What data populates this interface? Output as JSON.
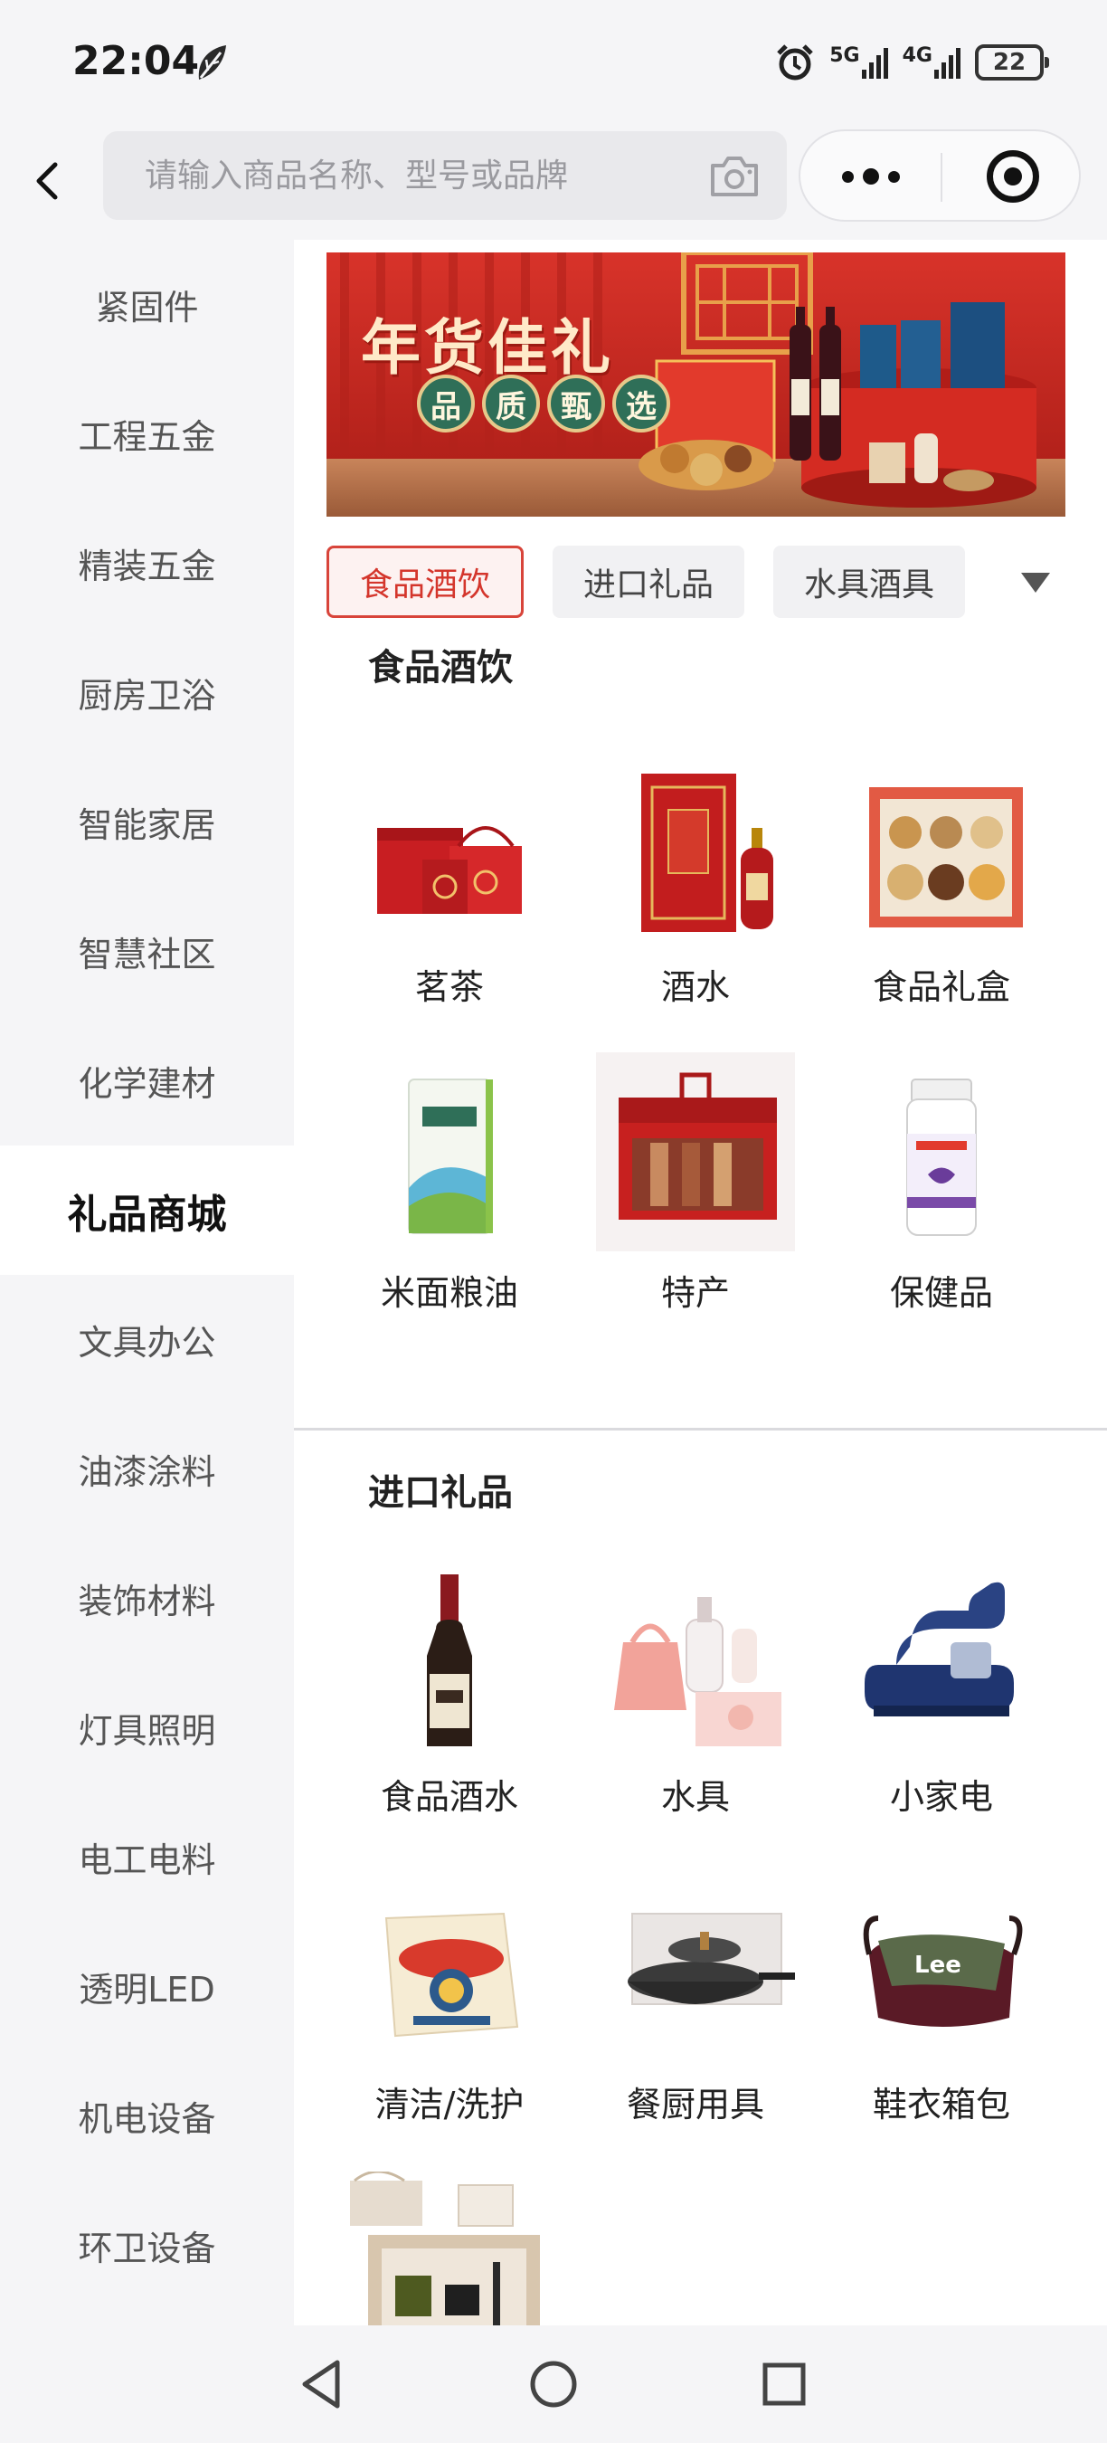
{
  "status_bar": {
    "time": "22:04",
    "network_1": "5G",
    "network_2": "4G",
    "battery": "22",
    "icons": [
      "leaf-icon",
      "alarm-icon",
      "signal-icon",
      "battery-icon"
    ]
  },
  "header": {
    "search_placeholder": "请输入商品名称、型号或品牌",
    "icons": [
      "back-arrow-icon",
      "camera-icon",
      "more-dots-icon",
      "target-close-icon"
    ]
  },
  "sidebar": {
    "items": [
      {
        "label": "紧固件"
      },
      {
        "label": "工程五金"
      },
      {
        "label": "精装五金"
      },
      {
        "label": "厨房卫浴"
      },
      {
        "label": "智能家居"
      },
      {
        "label": "智慧社区"
      },
      {
        "label": "化学建材"
      },
      {
        "label": "礼品商城"
      },
      {
        "label": "文具办公"
      },
      {
        "label": "油漆涂料"
      },
      {
        "label": "装饰材料"
      },
      {
        "label": "灯具照明"
      },
      {
        "label": "电工电料"
      },
      {
        "label": "透明LED"
      },
      {
        "label": "机电设备"
      },
      {
        "label": "环卫设备"
      }
    ],
    "active_label": "礼品商城"
  },
  "banner": {
    "title": "年货佳礼",
    "subtitle": [
      "品",
      "质",
      "甄",
      "选"
    ]
  },
  "tabs": [
    {
      "label": "食品酒饮"
    },
    {
      "label": "进口礼品"
    },
    {
      "label": "水具酒具"
    }
  ],
  "sections": [
    {
      "title": "食品酒饮",
      "items": [
        {
          "label": "茗茶",
          "icon": "tea-gift-box-image"
        },
        {
          "label": "酒水",
          "icon": "liquor-bottle-image"
        },
        {
          "label": "食品礼盒",
          "icon": "food-gift-box-image"
        },
        {
          "label": "米面粮油",
          "icon": "rice-bag-image"
        },
        {
          "label": "特产",
          "icon": "ham-gift-box-image"
        },
        {
          "label": "保健品",
          "icon": "supplement-bottle-image"
        }
      ]
    },
    {
      "title": "进口礼品",
      "items": [
        {
          "label": "食品酒水",
          "icon": "wine-bottle-image"
        },
        {
          "label": "水具",
          "icon": "water-bottle-set-image"
        },
        {
          "label": "小家电",
          "icon": "mite-vacuum-image"
        },
        {
          "label": "清洁/洗护",
          "icon": "soap-box-image"
        },
        {
          "label": "餐厨用具",
          "icon": "wok-pan-image"
        },
        {
          "label": "鞋衣箱包",
          "icon": "shoulder-bag-image"
        },
        {
          "label": "",
          "icon": "gift-set-image"
        }
      ]
    }
  ],
  "colors": {
    "accent_red": "#d8443a",
    "sidebar_bg": "#f5f5f7",
    "banner_red": "#c8281f"
  },
  "navbar": {
    "icons": [
      "back-triangle-icon",
      "home-circle-icon",
      "recents-square-icon"
    ]
  }
}
